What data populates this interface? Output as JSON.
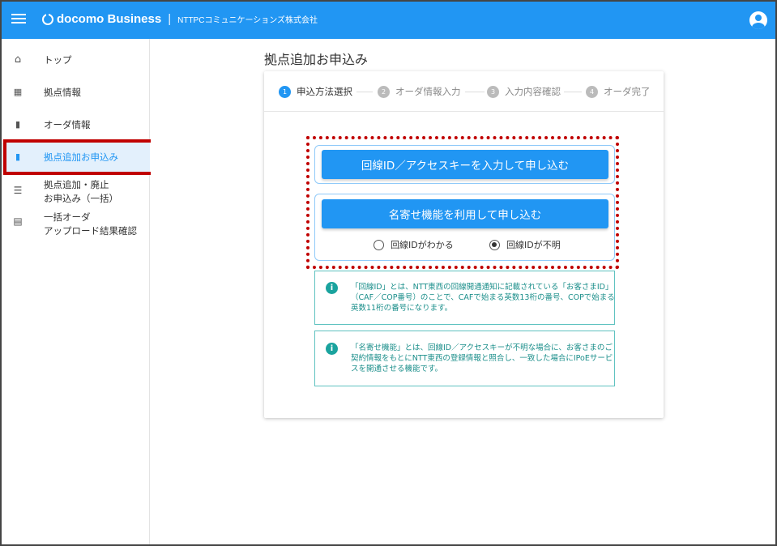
{
  "header": {
    "brand": "docomo Business",
    "company": "NTTPCコミュニケーションズ株式会社",
    "menu_icon": "hamburger-menu-icon",
    "account_icon": "account-circle-icon",
    "accent_color": "#2196f3"
  },
  "sidebar": {
    "items": [
      {
        "label": "トップ",
        "icon": "home-icon"
      },
      {
        "label": "拠点情報",
        "icon": "building-icon"
      },
      {
        "label": "オーダ情報",
        "icon": "document-icon"
      },
      {
        "label": "拠点追加お申込み",
        "icon": "document-add-icon",
        "active": true
      },
      {
        "label_line1": "拠点追加・廃止",
        "label_line2": "お申込み（一括）",
        "icon": "list-icon"
      },
      {
        "label_line1": "一括オーダ",
        "label_line2": "アップロード結果確認",
        "icon": "calendar-icon"
      }
    ]
  },
  "main": {
    "title": "拠点追加お申込み",
    "steps": [
      {
        "num": "1",
        "label": "申込方法選択",
        "active": true
      },
      {
        "num": "2",
        "label": "オーダ情報入力"
      },
      {
        "num": "3",
        "label": "入力内容確認"
      },
      {
        "num": "4",
        "label": "オーダ完了"
      }
    ],
    "option1_button": "回線ID／アクセスキーを入力して申し込む",
    "option2_button": "名寄せ機能を利用して申し込む",
    "radio_known": "回線IDがわかる",
    "radio_unknown": "回線IDが不明",
    "info1_icon": "i",
    "info1": "「回線ID」とは、NTT東西の回線開通通知に記載されている「お客さまID」（CAF／COP番号）のことで、CAFで始まる英数13桁の番号、COPで始まる英数11桁の番号になります。",
    "info2_icon": "i",
    "info2": "「名寄せ機能」とは、回線ID／アクセスキーが不明な場合に、お客さまのご契約情報をもとにNTT東西の登録情報と照合し、一致した場合にIPoEサービスを開通させる機能です。"
  }
}
